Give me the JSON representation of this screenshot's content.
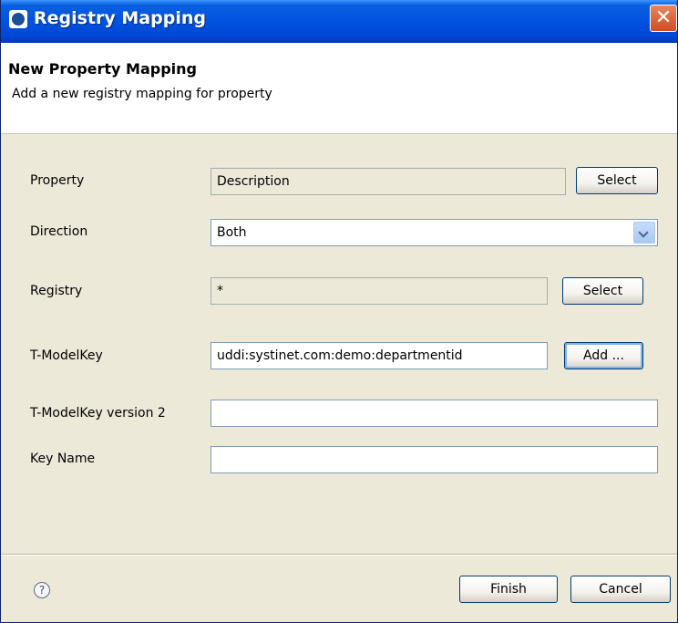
{
  "window": {
    "title": "Registry Mapping",
    "close_glyph": "✕"
  },
  "header": {
    "heading": "New Property Mapping",
    "description": "Add a new registry mapping for property"
  },
  "form": {
    "property": {
      "label": "Property",
      "value": "Description",
      "button": "Select"
    },
    "direction": {
      "label": "Direction",
      "value": "Both"
    },
    "registry": {
      "label": "Registry",
      "value": "*",
      "button": "Select"
    },
    "tmodelkey": {
      "label": "T-ModelKey",
      "value": "uddi:systinet.com:demo:departmentid",
      "button": "Add ..."
    },
    "tmodelkey_v2": {
      "label": "T-ModelKey version 2",
      "value": ""
    },
    "key_name": {
      "label": "Key Name",
      "value": ""
    }
  },
  "footer": {
    "help_glyph": "?",
    "finish": "Finish",
    "cancel": "Cancel"
  },
  "icons": {
    "app": "hp-logo-icon",
    "close": "close-icon",
    "dropdown": "chevron-down-icon",
    "help": "help-icon"
  }
}
